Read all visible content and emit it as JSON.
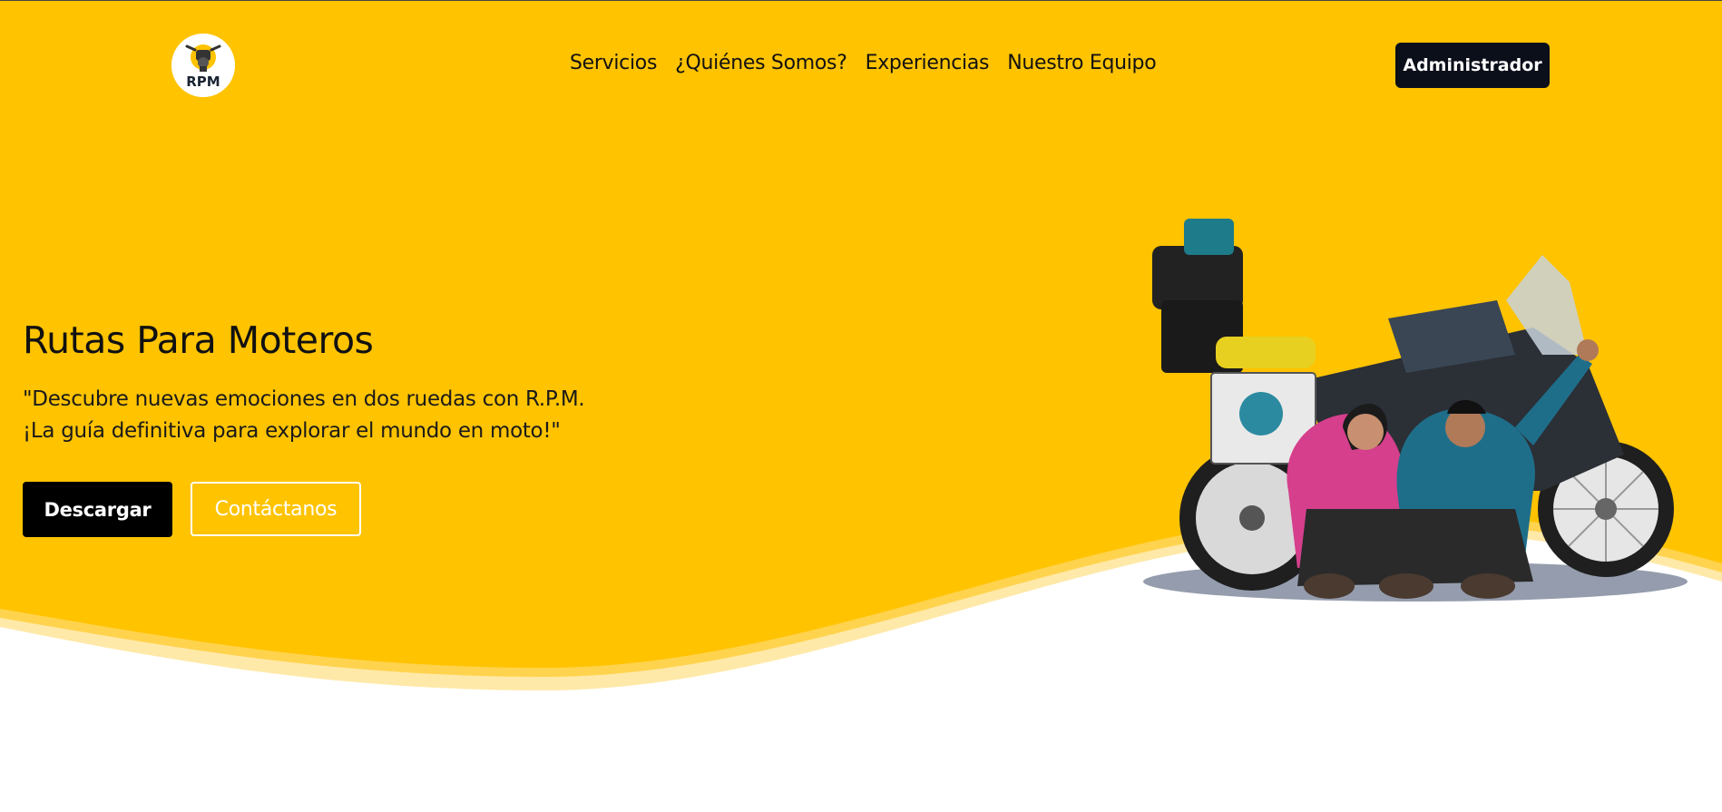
{
  "colors": {
    "hero_background": "#FFC300",
    "wave_light": "#FFE9A8",
    "wave_mid": "#FFD34D",
    "admin_button": "#0B0F1A",
    "primary_button": "#000000",
    "text_dark": "#111111"
  },
  "header": {
    "logo_text": "RPM",
    "logo_icon": "motorcycle-icon",
    "nav": [
      {
        "label": "Servicios"
      },
      {
        "label": "¿Quiénes Somos?"
      },
      {
        "label": "Experiencias"
      },
      {
        "label": "Nuestro Equipo"
      }
    ],
    "admin_label": "Administrador"
  },
  "hero": {
    "title": "Rutas Para Moteros",
    "subtitle_line1": "\"Descubre nuevas emociones en dos ruedas con R.P.M.",
    "subtitle_line2": "¡La guía definitiva para explorar el mundo en moto!\"",
    "download_label": "Descargar",
    "contact_label": "Contáctanos",
    "image": "motorcycle-riders-photo"
  }
}
